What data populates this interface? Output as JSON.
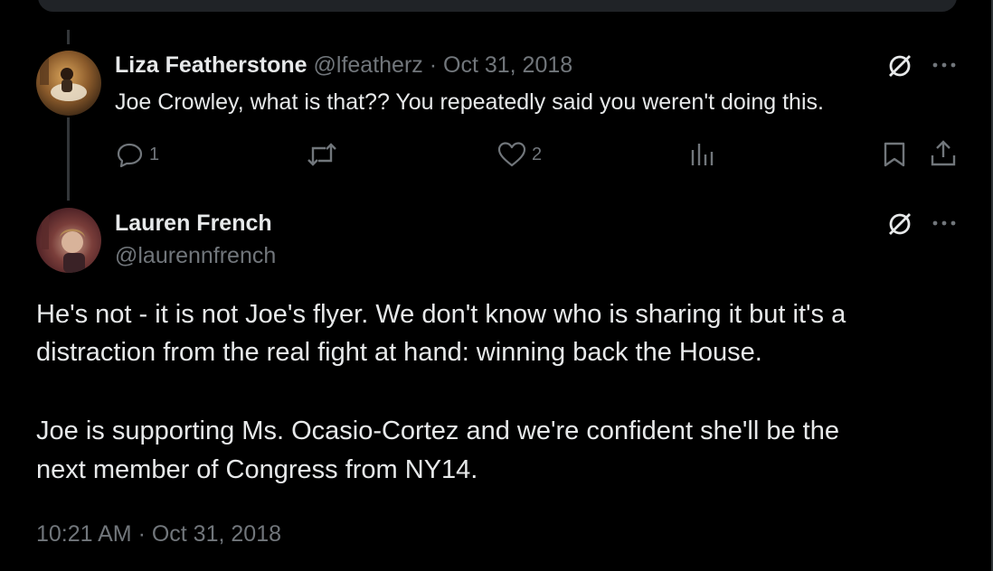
{
  "reply": {
    "author_name": "Liza Featherstone",
    "handle": "@lfeatherz",
    "separator": "·",
    "date": "Oct 31, 2018",
    "text": "Joe Crowley, what is that?? You repeatedly said you weren't doing this.",
    "reply_count": "1",
    "like_count": "2",
    "icons": [
      "grok-icon",
      "more-icon",
      "reply-icon",
      "retweet-icon",
      "like-icon",
      "views-icon",
      "bookmark-icon",
      "share-icon"
    ]
  },
  "main": {
    "author_name": "Lauren French",
    "handle": "@laurennfrench",
    "paragraph1_line1": "He's not - it is not Joe's flyer. We don't know who is sharing it but it's a",
    "paragraph1_line2": "distraction from the real fight at hand: winning back the House.",
    "paragraph2_line1": "Joe is supporting Ms. Ocasio-Cortez and we're confident she'll be the",
    "paragraph2_line2": "next member of Congress from NY14.",
    "timestamp": "10:21 AM · Oct 31, 2018"
  },
  "colors": {
    "background": "#000000",
    "text": "#e7e9ea",
    "muted": "#71767b",
    "line": "#333639"
  }
}
